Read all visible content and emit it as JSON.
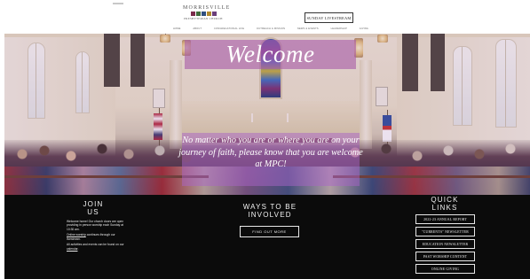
{
  "header": {
    "logo": {
      "top": "MORRISVILLE",
      "bottom": "PRESBYTERIAN CHURCH",
      "tile_colors": [
        "#7a2a4a",
        "#3e6b3a",
        "#2e4f80",
        "#b08a2e",
        "#6a3e7a"
      ]
    },
    "livestream_button": "SUNDAY LIVESTREAM",
    "nav": [
      "HOME",
      "ABOUT",
      "CONGREGATIONAL LIFE",
      "OUTREACH & MISSION",
      "NEWS & EVENTS",
      "LEADERSHIP",
      "GIVING"
    ]
  },
  "hero": {
    "title": "Welcome",
    "message": "No matter who you are or where you are on your journey of faith, please know that you are welcome at MPC!"
  },
  "footer": {
    "join": {
      "title_line1": "JOIN",
      "title_line2": "US",
      "p1": "Welcome home! Our church doors are open providing in person worship each Sunday at 10:30 am.",
      "p2_link": "Online worship",
      "p2_rest": " continues through our livestream.",
      "p3_text": "All activities and events can be found on our ",
      "p3_link": "calendar",
      "p3_end": "."
    },
    "involved": {
      "title_line1": "WAYS TO BE",
      "title_line2": "INVOLVED",
      "button": "FIND OUT MORE"
    },
    "quick_links": {
      "title_line1": "QUICK",
      "title_line2": "LINKS",
      "items": [
        "2022-23 ANNUAL REPORT",
        "\"CURRENTS\" NEWSLETTER",
        "EDUCATION NEWSLETTER",
        "PAST WORSHIP CONTENT",
        "ONLINE GIVING"
      ]
    }
  },
  "colors": {
    "overlay_purple": "#a85ca8",
    "footer_bg": "#0b0b0b"
  }
}
